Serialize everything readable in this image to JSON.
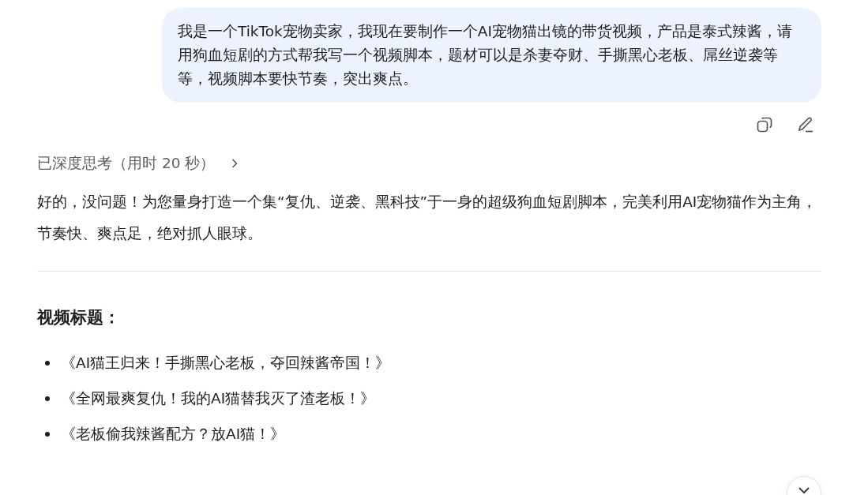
{
  "user_message": {
    "text": "我是一个TikTok宠物卖家，我现在要制作一个AI宠物猫出镜的带货视频，产品是泰式辣酱，请用狗血短剧的方式帮我写一个视频脚本，题材可以是杀妻夺财、手撕黑心老板、屌丝逆袭等等，视频脚本要快节奏，突出爽点。"
  },
  "thinking": {
    "label": "已深度思考（用时 20 秒）",
    "expanded": false
  },
  "reply": {
    "intro": "好的，没问题！为您量身打造一个集“复仇、逆袭、黑科技”于一身的超级狗血短剧脚本，完美利用AI宠物猫作为主角，节奏快、爽点足，绝对抓人眼球。",
    "heading": "视频标题：",
    "titles": [
      "《AI猫王归来！手撕黑心老板，夺回辣酱帝国！》",
      "《全网最爽复仇！我的AI猫替我灭了渣老板！》",
      "《老板偷我辣酱配方？放AI猫！》"
    ]
  }
}
